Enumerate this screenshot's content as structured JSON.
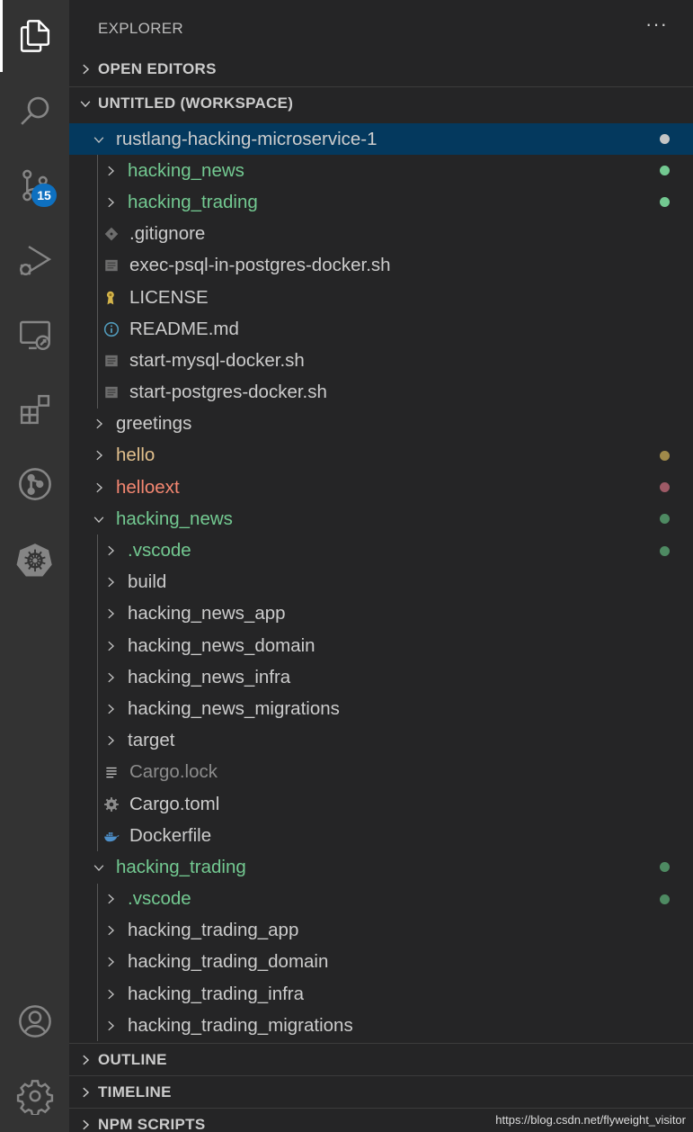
{
  "explorer": {
    "title": "EXPLORER",
    "more": "···"
  },
  "sections": {
    "open_editors": "OPEN EDITORS",
    "workspace": "UNTITLED (WORKSPACE)",
    "outline": "OUTLINE",
    "timeline": "TIMELINE",
    "npm_scripts": "NPM SCRIPTS"
  },
  "activity": {
    "scm_badge": "15",
    "items": [
      "explorer-icon",
      "search-icon",
      "source-control-icon",
      "run-debug-icon",
      "remote-explorer-icon",
      "extensions-icon",
      "git-graph-icon",
      "kubernetes-icon",
      "account-icon",
      "settings-gear-icon"
    ]
  },
  "colors": {
    "green": "#73c991",
    "yellow": "#e2c08d",
    "red": "#f48771",
    "selection": "#04395e",
    "badge": "#0e70c0"
  },
  "tree": [
    {
      "label": "rustlang-hacking-microservice-1",
      "depth": 0,
      "type": "folder",
      "open": true,
      "color": "white",
      "dot": "#c5c5c5",
      "selected": true
    },
    {
      "label": "hacking_news",
      "depth": 1,
      "type": "folder",
      "open": false,
      "color": "green",
      "dot": "#73c991"
    },
    {
      "label": "hacking_trading",
      "depth": 1,
      "type": "folder",
      "open": false,
      "color": "green",
      "dot": "#73c991"
    },
    {
      "label": ".gitignore",
      "depth": 1,
      "type": "file",
      "icon": "git-icon",
      "color": "white"
    },
    {
      "label": "exec-psql-in-postgres-docker.sh",
      "depth": 1,
      "type": "file",
      "icon": "shell-file-icon",
      "color": "white"
    },
    {
      "label": "LICENSE",
      "depth": 1,
      "type": "file",
      "icon": "license-icon",
      "color": "white"
    },
    {
      "label": "README.md",
      "depth": 1,
      "type": "file",
      "icon": "info-icon",
      "color": "white"
    },
    {
      "label": "start-mysql-docker.sh",
      "depth": 1,
      "type": "file",
      "icon": "shell-file-icon",
      "color": "white"
    },
    {
      "label": "start-postgres-docker.sh",
      "depth": 1,
      "type": "file",
      "icon": "shell-file-icon",
      "color": "white"
    },
    {
      "label": "greetings",
      "depth": 0,
      "type": "folder",
      "open": false,
      "color": "white"
    },
    {
      "label": "hello",
      "depth": 0,
      "type": "folder",
      "open": false,
      "color": "yellow",
      "dot": "#a08a4a"
    },
    {
      "label": "helloext",
      "depth": 0,
      "type": "folder",
      "open": false,
      "color": "red",
      "dot": "#9e5a66"
    },
    {
      "label": "hacking_news",
      "depth": 0,
      "type": "folder",
      "open": true,
      "color": "green",
      "dot": "#4e8a62"
    },
    {
      "label": ".vscode",
      "depth": 1,
      "type": "folder",
      "open": false,
      "color": "green",
      "dot": "#4e8a62"
    },
    {
      "label": "build",
      "depth": 1,
      "type": "folder",
      "open": false,
      "color": "white"
    },
    {
      "label": "hacking_news_app",
      "depth": 1,
      "type": "folder",
      "open": false,
      "color": "white"
    },
    {
      "label": "hacking_news_domain",
      "depth": 1,
      "type": "folder",
      "open": false,
      "color": "white"
    },
    {
      "label": "hacking_news_infra",
      "depth": 1,
      "type": "folder",
      "open": false,
      "color": "white"
    },
    {
      "label": "hacking_news_migrations",
      "depth": 1,
      "type": "folder",
      "open": false,
      "color": "white"
    },
    {
      "label": "target",
      "depth": 1,
      "type": "folder",
      "open": false,
      "color": "white"
    },
    {
      "label": "Cargo.lock",
      "depth": 1,
      "type": "file",
      "icon": "lines-file-icon",
      "color": "gray"
    },
    {
      "label": "Cargo.toml",
      "depth": 1,
      "type": "file",
      "icon": "gear-file-icon",
      "color": "white"
    },
    {
      "label": "Dockerfile",
      "depth": 1,
      "type": "file",
      "icon": "docker-icon",
      "color": "white"
    },
    {
      "label": "hacking_trading",
      "depth": 0,
      "type": "folder",
      "open": true,
      "color": "green",
      "dot": "#4e8a62"
    },
    {
      "label": ".vscode",
      "depth": 1,
      "type": "folder",
      "open": false,
      "color": "green",
      "dot": "#4e8a62"
    },
    {
      "label": "hacking_trading_app",
      "depth": 1,
      "type": "folder",
      "open": false,
      "color": "white"
    },
    {
      "label": "hacking_trading_domain",
      "depth": 1,
      "type": "folder",
      "open": false,
      "color": "white"
    },
    {
      "label": "hacking_trading_infra",
      "depth": 1,
      "type": "folder",
      "open": false,
      "color": "white"
    },
    {
      "label": "hacking_trading_migrations",
      "depth": 1,
      "type": "folder",
      "open": false,
      "color": "white"
    }
  ],
  "watermark": "https://blog.csdn.net/flyweight_visitor"
}
